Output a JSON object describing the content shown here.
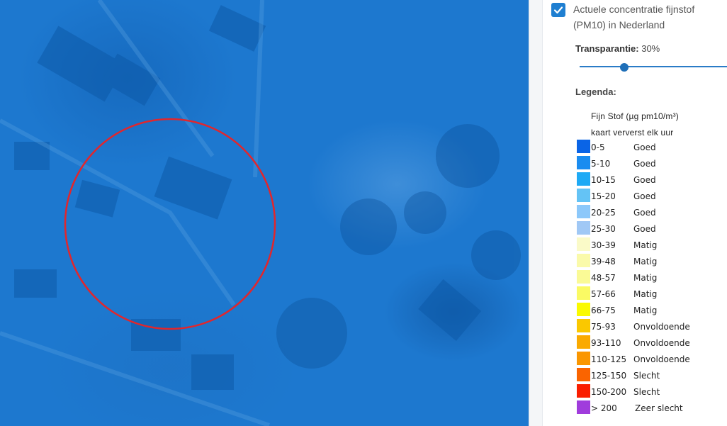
{
  "layer": {
    "checked": true,
    "title": "Actuele concentratie fijnstof (PM10) in Nederland"
  },
  "transparency": {
    "label": "Transparantie:",
    "value": "30%",
    "level_percent": 30
  },
  "legend": {
    "heading": "Legenda:",
    "unit_line": "Fijn Stof (µg pm10/m³)",
    "refresh_line": "kaart ververst elk uur",
    "rows": [
      {
        "range": "0-5",
        "quality": "Goed",
        "color": "#0a64e6"
      },
      {
        "range": "5-10",
        "quality": "Goed",
        "color": "#1a8cf0"
      },
      {
        "range": "10-15",
        "quality": "Goed",
        "color": "#1eaaf5"
      },
      {
        "range": "15-20",
        "quality": "Goed",
        "color": "#64c3f5"
      },
      {
        "range": "20-25",
        "quality": "Goed",
        "color": "#8cc8fa"
      },
      {
        "range": "25-30",
        "quality": "Goed",
        "color": "#a0c8f5"
      },
      {
        "range": "30-39",
        "quality": "Matig",
        "color": "#fafac8"
      },
      {
        "range": "39-48",
        "quality": "Matig",
        "color": "#fafaaa"
      },
      {
        "range": "48-57",
        "quality": "Matig",
        "color": "#fafa96"
      },
      {
        "range": "57-66",
        "quality": "Matig",
        "color": "#fafa64"
      },
      {
        "range": "66-75",
        "quality": "Matig",
        "color": "#fafa00"
      },
      {
        "range": "75-93",
        "quality": "Onvoldoende",
        "color": "#fac800"
      },
      {
        "range": "93-110",
        "quality": "Onvoldoende",
        "color": "#faaa00"
      },
      {
        "range": "110-125",
        "quality": "Onvoldoende",
        "color": "#fa9600"
      },
      {
        "range": "125-150",
        "quality": "Slecht",
        "color": "#fa6400"
      },
      {
        "range": "150-200",
        "quality": "Slecht",
        "color": "#fa1e00"
      },
      {
        "range": "> 200",
        "quality": "Zeer slecht",
        "color": "#a03cdc"
      }
    ]
  },
  "map": {
    "overlay_color": "#1d78cf",
    "marker_color": "#e2262c"
  }
}
